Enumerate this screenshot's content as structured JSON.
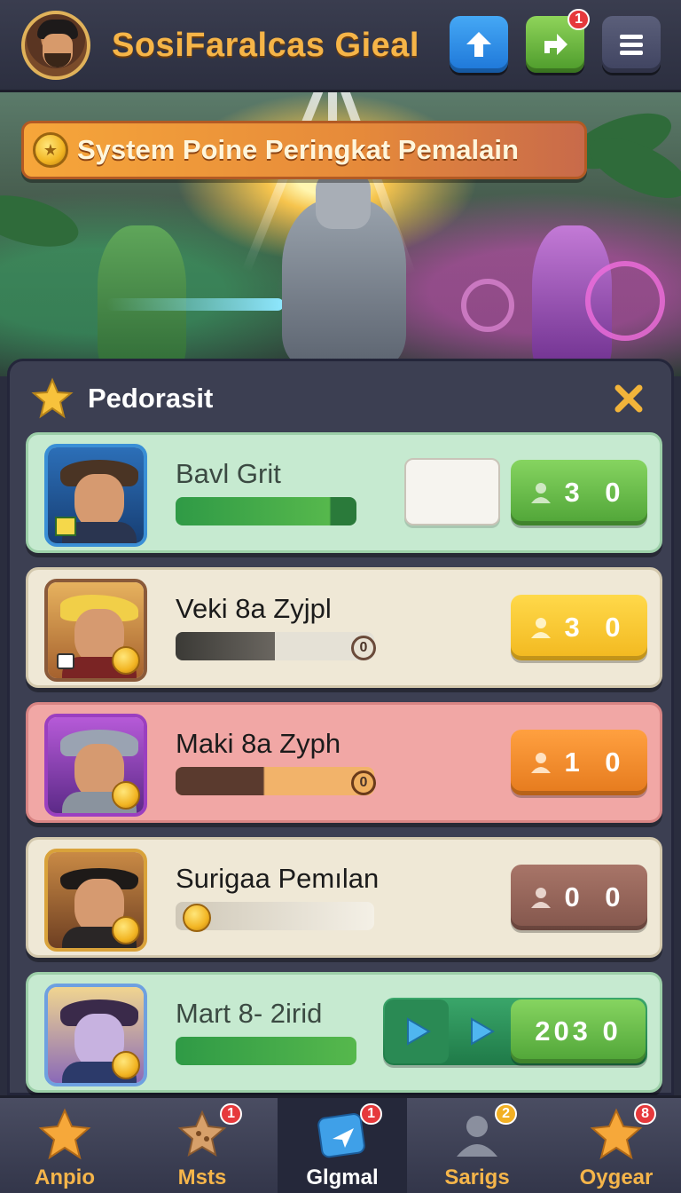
{
  "header": {
    "title": "SosiFaralcas Gieal",
    "buttons": [
      {
        "name": "upload-button",
        "icon": "arrow-up-icon"
      },
      {
        "name": "share-button",
        "icon": "arrow-right-icon",
        "badge": "1"
      },
      {
        "name": "menu-button",
        "icon": "hamburger-icon"
      }
    ]
  },
  "hero": {
    "banner_text": "System Poine Peringkat Pemalain"
  },
  "panel": {
    "title": "Pedorasit",
    "rows": [
      {
        "name": "Bavl Grit",
        "progress": 1.0,
        "score": "3 0",
        "style": "green"
      },
      {
        "name": "Veki 8a Zyjpl",
        "progress": 0.5,
        "dot": "0",
        "score": "3 0",
        "style": "yellow"
      },
      {
        "name": "Maki 8a Zyph",
        "progress": 1.0,
        "dot": "0",
        "score": "1 0",
        "style": "orange"
      },
      {
        "name": "Surigaa Pemılan",
        "progress": 0.0,
        "score": "0 0",
        "style": "brown"
      },
      {
        "name": "Mart 8- 2irid",
        "progress": 1.0,
        "score": "203 0",
        "style": "green-play"
      }
    ]
  },
  "nav": [
    {
      "label": "Anpio",
      "icon": "star-icon",
      "badge": null,
      "active": false
    },
    {
      "label": "Msts",
      "icon": "cookie-icon",
      "badge": "1",
      "active": false
    },
    {
      "label": "Glgmal",
      "icon": "send-icon",
      "badge": "1",
      "active": true
    },
    {
      "label": "Sarigs",
      "icon": "person-icon",
      "badge": "2",
      "active": false
    },
    {
      "label": "Oygear",
      "icon": "star-icon",
      "badge": "8",
      "active": false
    }
  ],
  "colors": {
    "accent_orange": "#f6b548",
    "header_bg": "#2c2f40",
    "panel_bg": "#3c3f52",
    "badge_red": "#e6393c"
  }
}
